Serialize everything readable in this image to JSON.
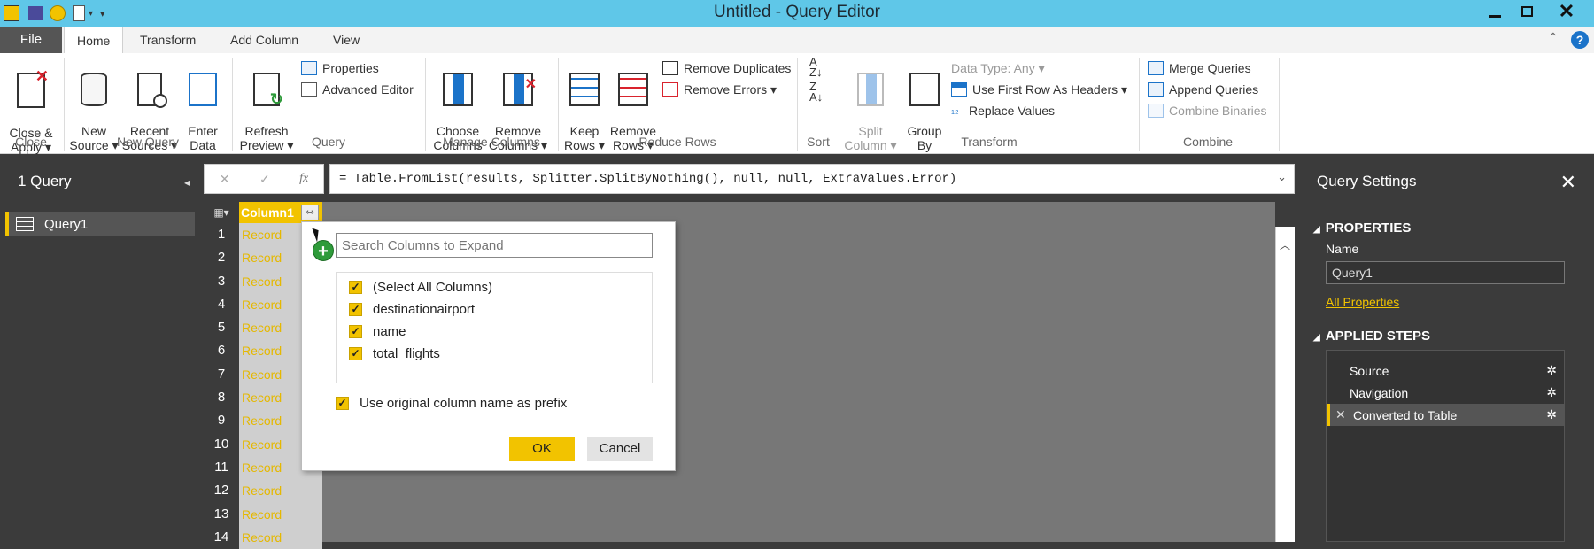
{
  "window": {
    "title": "Untitled - Query Editor"
  },
  "tabs": [
    {
      "label": "File"
    },
    {
      "label": "Home"
    },
    {
      "label": "Transform"
    },
    {
      "label": "Add Column"
    },
    {
      "label": "View"
    }
  ],
  "ribbon": {
    "close_apply": "Close &\nApply ▾",
    "new_source": "New\nSource ▾",
    "recent_sources": "Recent\nSources ▾",
    "enter_data": "Enter\nData",
    "refresh_preview": "Refresh\nPreview ▾",
    "properties": "Properties",
    "advanced_editor": "Advanced Editor",
    "choose_columns": "Choose\nColumns",
    "remove_columns": "Remove\nColumns ▾",
    "keep_rows": "Keep\nRows ▾",
    "remove_rows": "Remove\nRows ▾",
    "remove_duplicates": "Remove Duplicates",
    "remove_errors": "Remove Errors ▾",
    "split_column": "Split\nColumn ▾",
    "group_by": "Group\nBy",
    "data_type": "Data Type: Any ▾",
    "use_first_row": "Use First Row As Headers ▾",
    "replace_values": "Replace Values",
    "merge_queries": "Merge Queries",
    "append_queries": "Append Queries",
    "combine_binaries": "Combine Binaries",
    "groups": {
      "close": "Close",
      "new_query": "New Query",
      "query": "Query",
      "manage_columns": "Manage Columns",
      "reduce_rows": "Reduce Rows",
      "sort": "Sort",
      "transform": "Transform",
      "combine": "Combine"
    }
  },
  "left_pane": {
    "header": "1 Query",
    "queries": [
      {
        "name": "Query1"
      }
    ]
  },
  "formula_bar": {
    "fx": "fx",
    "formula": "= Table.FromList(results, Splitter.SplitByNothing(), null, null, ExtraValues.Error)"
  },
  "grid": {
    "column_header": "Column1",
    "rows": [
      {
        "num": "1",
        "value": "Record"
      },
      {
        "num": "2",
        "value": "Record"
      },
      {
        "num": "3",
        "value": "Record"
      },
      {
        "num": "4",
        "value": "Record"
      },
      {
        "num": "5",
        "value": "Record"
      },
      {
        "num": "6",
        "value": "Record"
      },
      {
        "num": "7",
        "value": "Record"
      },
      {
        "num": "8",
        "value": "Record"
      },
      {
        "num": "9",
        "value": "Record"
      },
      {
        "num": "10",
        "value": "Record"
      },
      {
        "num": "11",
        "value": "Record"
      },
      {
        "num": "12",
        "value": "Record"
      },
      {
        "num": "13",
        "value": "Record"
      },
      {
        "num": "14",
        "value": "Record"
      }
    ]
  },
  "expand_dialog": {
    "search_placeholder": "Search Columns to Expand",
    "columns": [
      {
        "label": "(Select All Columns)",
        "checked": true
      },
      {
        "label": "destinationairport",
        "checked": true
      },
      {
        "label": "name",
        "checked": true
      },
      {
        "label": "total_flights",
        "checked": true
      }
    ],
    "prefix_label": "Use original column name as prefix",
    "prefix_checked": true,
    "ok": "OK",
    "cancel": "Cancel"
  },
  "query_settings": {
    "header": "Query Settings",
    "properties_header": "PROPERTIES",
    "name_label": "Name",
    "name_value": "Query1",
    "all_properties": "All Properties",
    "applied_steps_header": "APPLIED STEPS",
    "steps": [
      {
        "name": "Source"
      },
      {
        "name": "Navigation"
      },
      {
        "name": "Converted to Table",
        "selected": true
      }
    ]
  },
  "colors": {
    "accent": "#f2c300",
    "titlebar": "#5fc7e8",
    "dark": "#3b3b3b"
  }
}
